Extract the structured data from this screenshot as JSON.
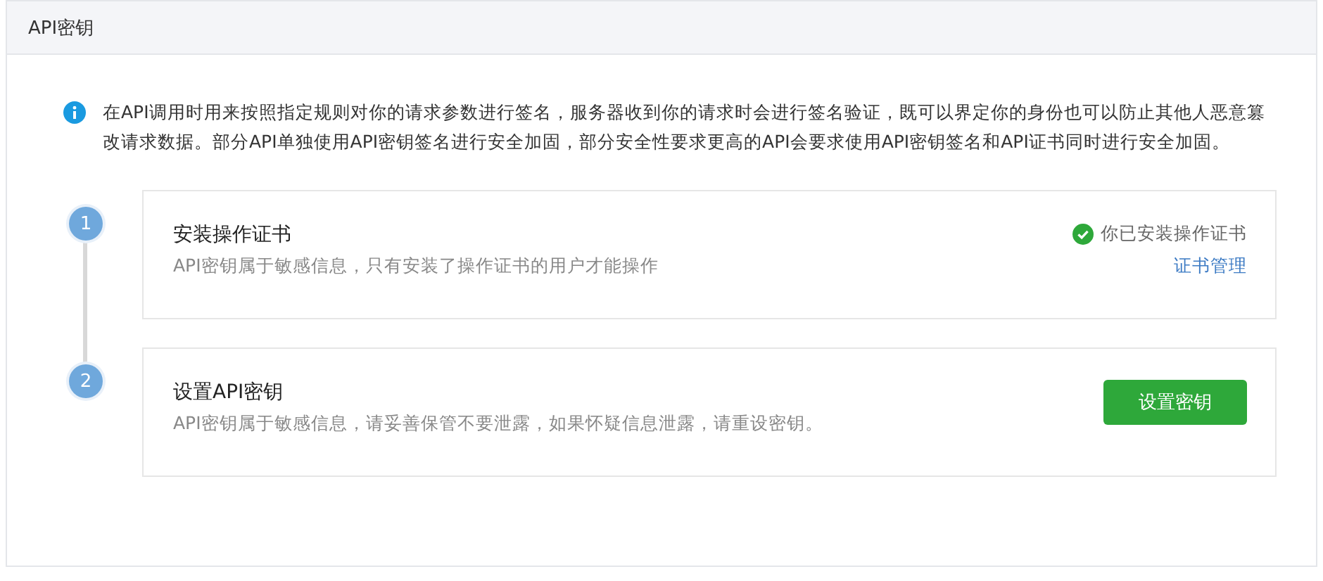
{
  "header": {
    "title": "API密钥"
  },
  "notice": {
    "text": "在API调用时用来按照指定规则对你的请求参数进行签名，服务器收到你的请求时会进行签名验证，既可以界定你的身份也可以防止其他人恶意篡改请求数据。部分API单独使用API密钥签名进行安全加固，部分安全性要求更高的API会要求使用API密钥签名和API证书同时进行安全加固。"
  },
  "steps": [
    {
      "number": "1",
      "title": "安装操作证书",
      "description": "API密钥属于敏感信息，只有安装了操作证书的用户才能操作",
      "kind": "status",
      "status": "你已安装操作证书",
      "link": "证书管理"
    },
    {
      "number": "2",
      "title": "设置API密钥",
      "description": "API密钥属于敏感信息，请妥善保管不要泄露，如果怀疑信息泄露，请重设密钥。",
      "kind": "action",
      "button": "设置密钥"
    }
  ]
}
